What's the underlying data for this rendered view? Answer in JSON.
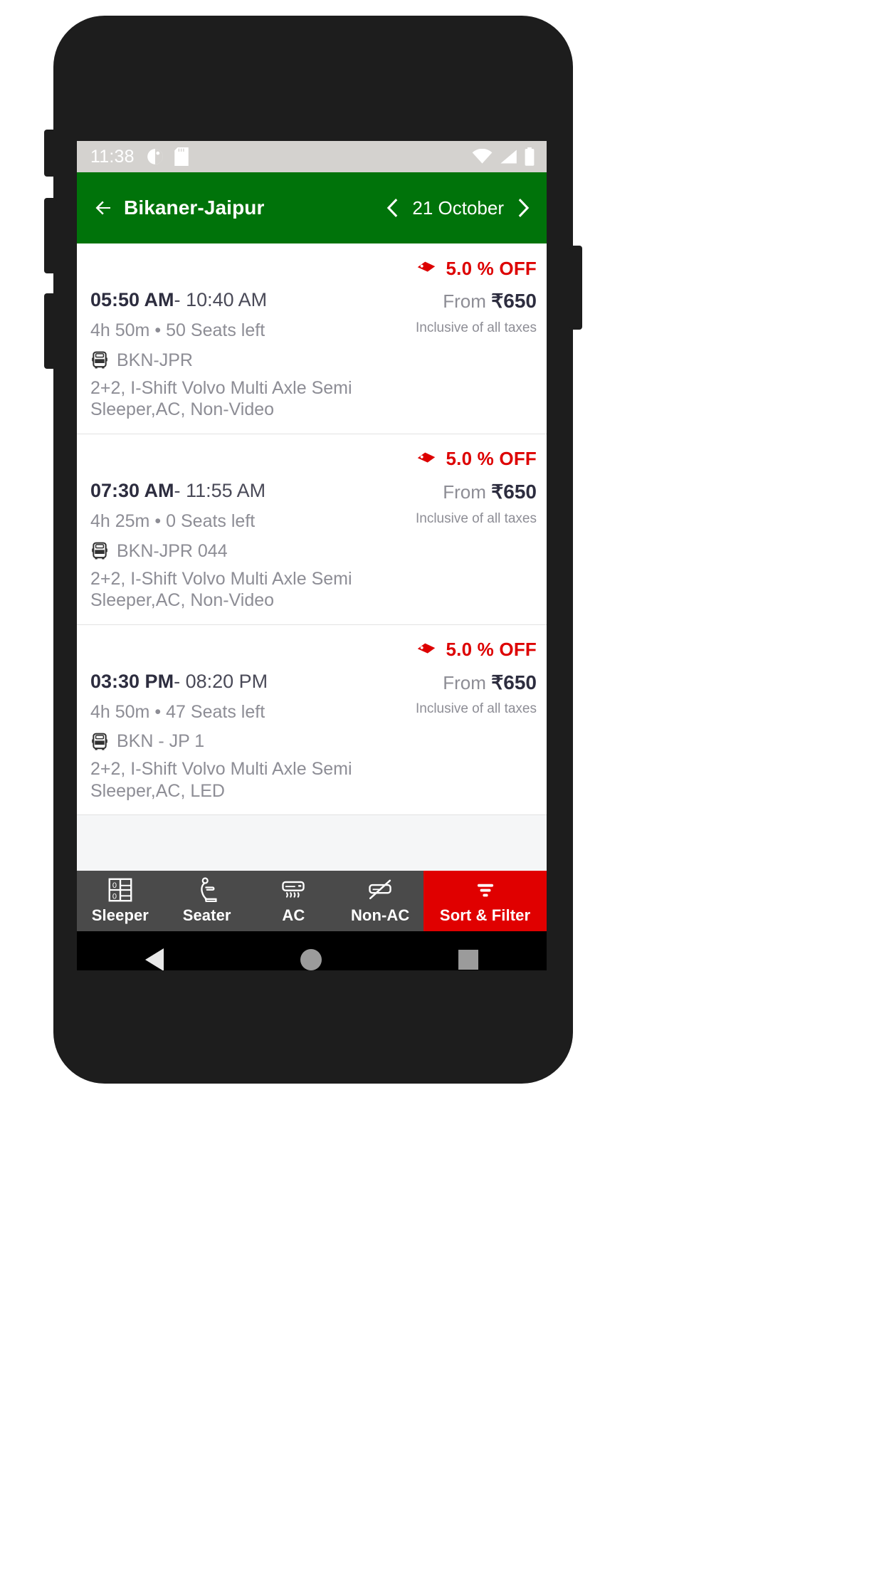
{
  "status_bar": {
    "time": "11:38",
    "left_icons": [
      "screenshot-icon",
      "sd-card-icon"
    ],
    "right_icons": [
      "wifi-icon",
      "signal-icon",
      "battery-icon"
    ]
  },
  "app_bar": {
    "back_icon": "back-arrow-icon",
    "route_title": "Bikaner-Jaipur",
    "prev_icon": "chevron-left-icon",
    "date": "21 October",
    "next_icon": "chevron-right-icon",
    "background_color": "#00730A"
  },
  "buses": [
    {
      "discount_icon": "price-tag-icon",
      "discount": "5.0 % OFF",
      "departure": "05:50 AM",
      "separator": "-",
      "arrival": "10:40 AM",
      "duration": "4h 50m",
      "bullet": "•",
      "seats": "50 Seats left",
      "bus_icon": "bus-icon",
      "bus_name": "BKN-JPR",
      "bus_type": "2+2, I-Shift Volvo Multi Axle Semi Sleeper,AC, Non-Video",
      "price_prefix": "From",
      "currency": "₹",
      "price": "650",
      "tax_note": "Inclusive of all taxes"
    },
    {
      "discount_icon": "price-tag-icon",
      "discount": "5.0 % OFF",
      "departure": "07:30 AM",
      "separator": "-",
      "arrival": "11:55 AM",
      "duration": "4h 25m",
      "bullet": "•",
      "seats": "0 Seats left",
      "bus_icon": "bus-icon",
      "bus_name": "BKN-JPR 044",
      "bus_type": "2+2, I-Shift Volvo Multi Axle Semi Sleeper,AC, Non-Video",
      "price_prefix": "From",
      "currency": "₹",
      "price": "650",
      "tax_note": "Inclusive of all taxes"
    },
    {
      "discount_icon": "price-tag-icon",
      "discount": "5.0 % OFF",
      "departure": "03:30 PM",
      "separator": "-",
      "arrival": "08:20 PM",
      "duration": "4h 50m",
      "bullet": "•",
      "seats": "47 Seats left",
      "bus_icon": "bus-icon",
      "bus_name": "BKN - JP 1",
      "bus_type": "2+2, I-Shift Volvo Multi Axle Semi Sleeper,AC, LED",
      "price_prefix": "From",
      "currency": "₹",
      "price": "650",
      "tax_note": "Inclusive of all taxes"
    }
  ],
  "filter_bar": {
    "background_color": "#4A4A4A",
    "accent_color": "#E00000",
    "items": [
      {
        "icon": "sleeper-berth-icon",
        "label": "Sleeper",
        "active": false
      },
      {
        "icon": "seat-icon",
        "label": "Seater",
        "active": false
      },
      {
        "icon": "air-conditioner-icon",
        "label": "AC",
        "active": false
      },
      {
        "icon": "air-conditioner-off-icon",
        "label": "Non-AC",
        "active": false
      },
      {
        "icon": "filter-funnel-icon",
        "label": "Sort & Filter",
        "active": true
      }
    ]
  },
  "nav_bar": {
    "back_icon": "android-back-icon",
    "home_icon": "android-home-icon",
    "recents_icon": "android-recents-icon"
  }
}
